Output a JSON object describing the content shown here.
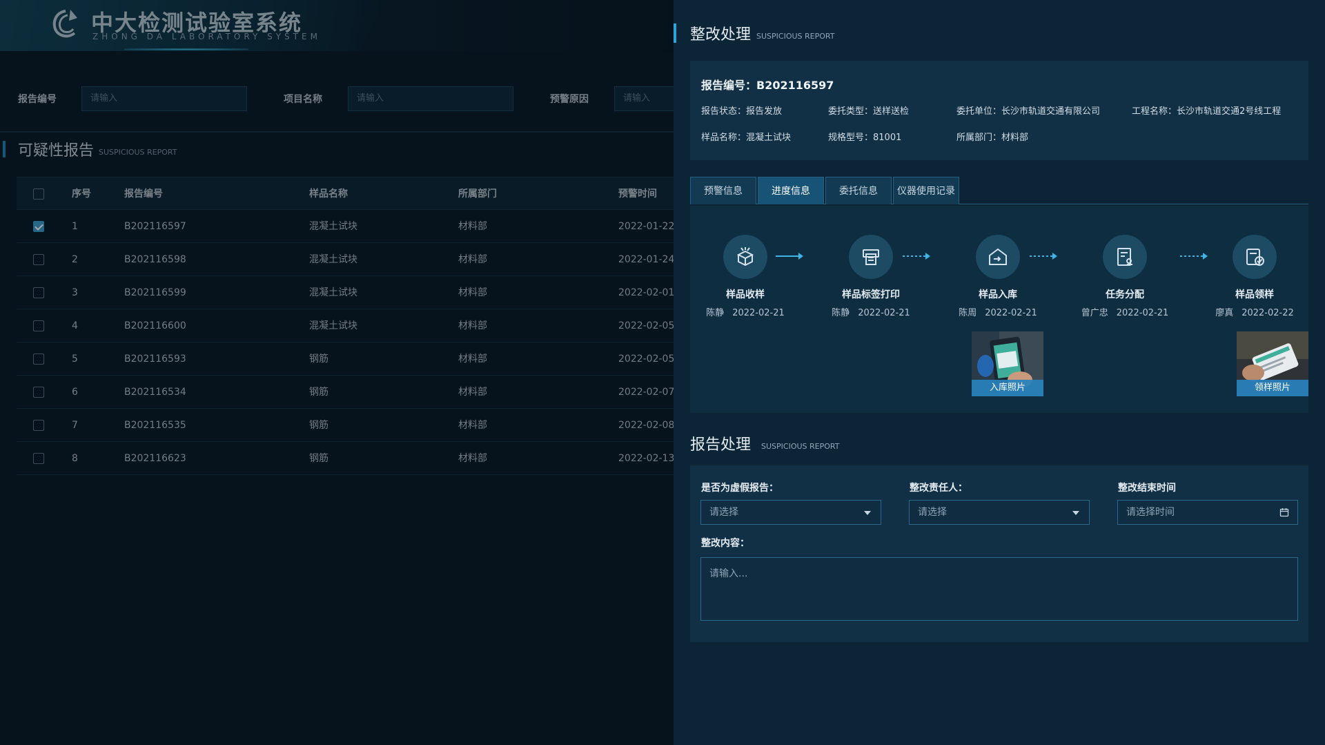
{
  "brand": {
    "title": "中大检测试验室系统",
    "subtitle": "ZHONG DA LABORATORY SYSTEM"
  },
  "filters": [
    {
      "label": "报告编号",
      "placeholder": "请输入"
    },
    {
      "label": "项目名称",
      "placeholder": "请输入"
    },
    {
      "label": "预警原因",
      "placeholder": "请输入"
    }
  ],
  "list_section": {
    "title": "可疑性报告",
    "subtitle": "SUSPICIOUS REPORT"
  },
  "table": {
    "headers": [
      "序号",
      "报告编号",
      "样品名称",
      "所属部门",
      "预警时间"
    ],
    "rows": [
      {
        "checked": true,
        "no": "1",
        "code": "B202116597",
        "sample": "混凝土试块",
        "dept": "材料部",
        "time": "2022-01-22"
      },
      {
        "checked": false,
        "no": "2",
        "code": "B202116598",
        "sample": "混凝土试块",
        "dept": "材料部",
        "time": "2022-01-24"
      },
      {
        "checked": false,
        "no": "3",
        "code": "B202116599",
        "sample": "混凝土试块",
        "dept": "材料部",
        "time": "2022-02-01"
      },
      {
        "checked": false,
        "no": "4",
        "code": "B202116600",
        "sample": "混凝土试块",
        "dept": "材料部",
        "time": "2022-02-05"
      },
      {
        "checked": false,
        "no": "5",
        "code": "B202116593",
        "sample": "钢筋",
        "dept": "材料部",
        "time": "2022-02-05"
      },
      {
        "checked": false,
        "no": "6",
        "code": "B202116534",
        "sample": "钢筋",
        "dept": "材料部",
        "time": "2022-02-07"
      },
      {
        "checked": false,
        "no": "7",
        "code": "B202116535",
        "sample": "钢筋",
        "dept": "材料部",
        "time": "2022-02-08"
      },
      {
        "checked": false,
        "no": "8",
        "code": "B202116623",
        "sample": "钢筋",
        "dept": "材料部",
        "time": "2022-02-13"
      }
    ]
  },
  "drawer": {
    "title": "整改处理",
    "subtitle": "SUSPICIOUS REPORT",
    "report_no": "报告编号：B202116597",
    "info": {
      "status": "报告状态：报告发放",
      "entrust_type": "委托类型：送样送检",
      "entrust_unit": "委托单位：长沙市轨道交通有限公司",
      "project": "工程名称：长沙市轨道交通2号线工程",
      "sample": "样品名称：混凝土试块",
      "spec": "规格型号：81001",
      "dept": "所属部门：材料部"
    },
    "tabs": [
      "预警信息",
      "进度信息",
      "委托信息",
      "仪器使用记录"
    ],
    "active_tab": 1,
    "steps": [
      {
        "name": "样品收样",
        "person": "陈静",
        "date": "2022-02-21",
        "icon": "box-receive-icon"
      },
      {
        "name": "样品标签打印",
        "person": "陈静",
        "date": "2022-02-21",
        "icon": "label-print-icon"
      },
      {
        "name": "样品入库",
        "person": "陈周",
        "date": "2022-02-21",
        "icon": "warehouse-in-icon"
      },
      {
        "name": "任务分配",
        "person": "曾广忠",
        "date": "2022-02-21",
        "icon": "task-assign-icon"
      },
      {
        "name": "样品领样",
        "person": "廖真",
        "date": "2022-02-22",
        "icon": "sample-collect-icon"
      }
    ],
    "photos": {
      "storage": "入库照片",
      "collect": "领样照片"
    },
    "handling": {
      "title": "报告处理",
      "subtitle": "SUSPICIOUS REPORT",
      "fake_label": "是否为虚假报告：",
      "fake_placeholder": "请选择",
      "owner_label": "整改责任人：",
      "owner_placeholder": "请选择",
      "end_label": "整改结束时间",
      "end_placeholder": "请选择时间",
      "content_label": "整改内容：",
      "content_placeholder": "请输入..."
    }
  }
}
